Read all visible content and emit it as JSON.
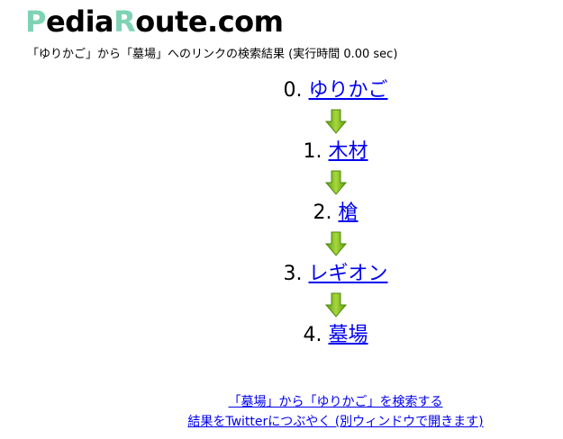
{
  "logo": {
    "p": "P",
    "edia": "edia",
    "r": "R",
    "oute": "oute.com",
    "accent_color": "#7fd3b5"
  },
  "summary": "「ゆりかご」から「墓場」へのリンクの検索結果 (実行時間 0.00 sec)",
  "route": {
    "steps": [
      {
        "number": "0.",
        "label": "ゆりかご"
      },
      {
        "number": "1.",
        "label": "木材"
      },
      {
        "number": "2.",
        "label": "槍"
      },
      {
        "number": "3.",
        "label": "レギオン"
      },
      {
        "number": "4.",
        "label": "墓場"
      }
    ],
    "arrow_icon": "down-arrow-icon",
    "arrow_color": "#7fb81f"
  },
  "footer": {
    "reverse_search_link": "「墓場」から「ゆりかご」を検索する",
    "twitter_link": "結果をTwitterにつぶやく (別ウィンドウで開きます)"
  }
}
